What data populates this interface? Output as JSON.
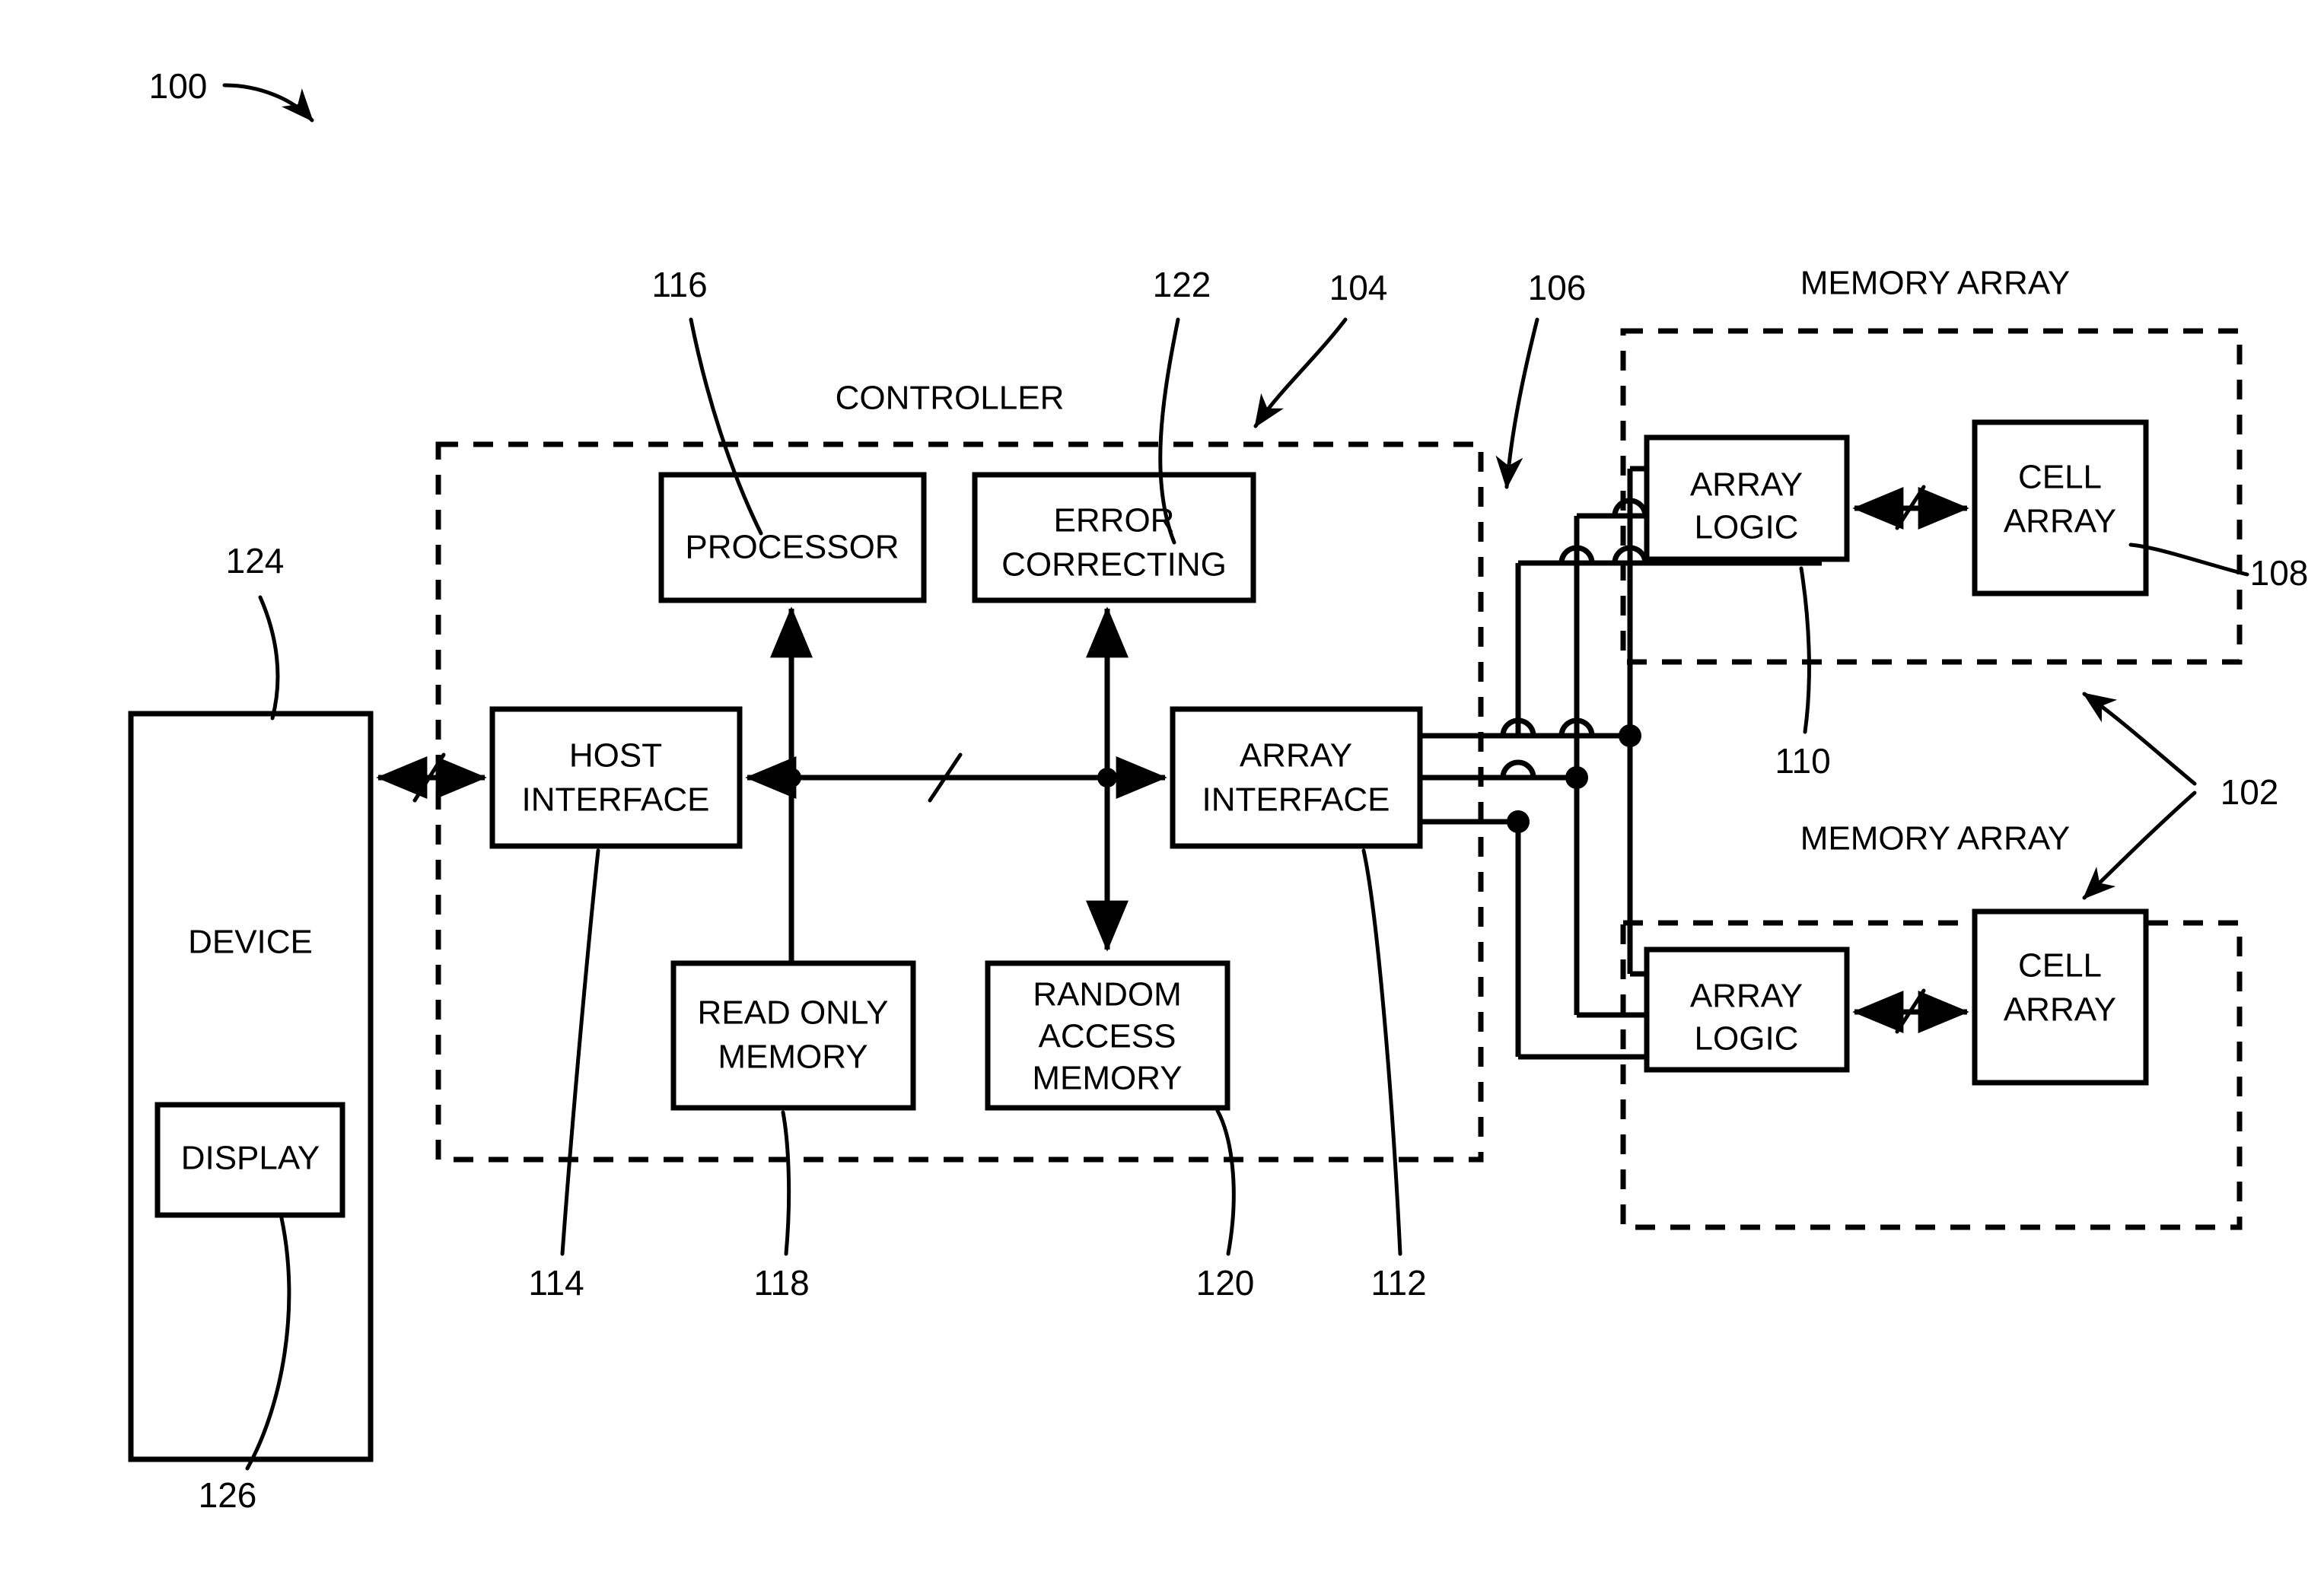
{
  "figure": {
    "figure_number": "100",
    "blocks": {
      "device": "DEVICE",
      "display": "DISPLAY",
      "controller": "CONTROLLER",
      "processor": "PROCESSOR",
      "error_correcting_line1": "ERROR",
      "error_correcting_line2": "CORRECTING",
      "host_interface_line1": "HOST",
      "host_interface_line2": "INTERFACE",
      "array_interface_line1": "ARRAY",
      "array_interface_line2": "INTERFACE",
      "read_only_memory_line1": "READ ONLY",
      "read_only_memory_line2": "MEMORY",
      "random_access_memory_line1": "RANDOM",
      "random_access_memory_line2": "ACCESS",
      "random_access_memory_line3": "MEMORY",
      "memory_array_top": "MEMORY ARRAY",
      "memory_array_bottom": "MEMORY ARRAY",
      "array_logic_top_line1": "ARRAY",
      "array_logic_top_line2": "LOGIC",
      "cell_array_top_line1": "CELL",
      "cell_array_top_line2": "ARRAY",
      "array_logic_bottom_line1": "ARRAY",
      "array_logic_bottom_line2": "LOGIC",
      "cell_array_bottom_line1": "CELL",
      "cell_array_bottom_line2": "ARRAY"
    },
    "reference_numerals": {
      "system": "100",
      "memory_arrays": "102",
      "controller": "104",
      "bus_to_arrays": "106",
      "cell_array": "108",
      "array_logic": "110",
      "array_interface": "112",
      "host_interface": "114",
      "processor": "116",
      "read_only_memory": "118",
      "random_access_memory": "120",
      "error_correcting": "122",
      "device": "124",
      "display": "126"
    },
    "colors": {
      "ink": "#000000",
      "background": "#ffffff"
    }
  }
}
